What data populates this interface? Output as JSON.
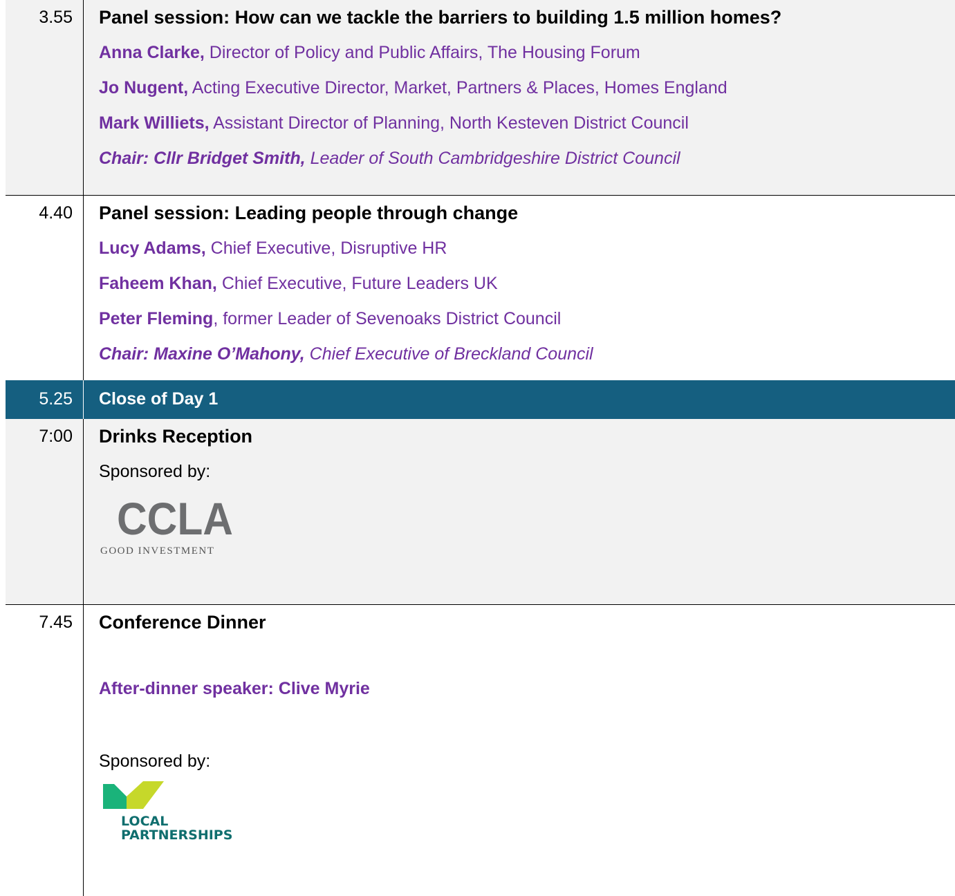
{
  "agenda": {
    "rows": [
      {
        "time": "3.55",
        "title": "Panel session: How can we tackle the barriers to building 1.5 million homes?",
        "speakers": [
          {
            "name": "Anna Clarke,",
            "role": " Director of Policy and Public Affairs, The Housing Forum"
          },
          {
            "name": "Jo Nugent,",
            "role": " Acting Executive Director, Market, Partners & Places, Homes England"
          },
          {
            "name": "Mark Williets,",
            "role": " Assistant Director of Planning, North Kesteven District Council"
          }
        ],
        "chair": {
          "name": "Chair: Cllr Bridget Smith,",
          "role": " Leader of South Cambridgeshire District Council"
        }
      },
      {
        "time": "4.40",
        "title": "Panel session: Leading people through change",
        "speakers": [
          {
            "name": "Lucy Adams,",
            "role": " Chief Executive, Disruptive HR"
          },
          {
            "name": "Faheem Khan,",
            "role": " Chief Executive, Future Leaders UK"
          },
          {
            "name": "Peter Fleming",
            "role": ", former Leader of Sevenoaks District Council"
          }
        ],
        "chair": {
          "name": "Chair: Maxine O’Mahony,",
          "role": " Chief Executive of Breckland Council"
        }
      },
      {
        "time": "5.25",
        "title": "Close of Day 1"
      },
      {
        "time": "7:00",
        "title": "Drinks Reception",
        "sponsored_label": "Sponsored by:",
        "logo": {
          "wordmark": "CCLA",
          "tagline": "GOOD INVESTMENT",
          "color": "#6d6e70"
        }
      },
      {
        "time": "7.45",
        "title": "Conference Dinner",
        "speaker_line": "After-dinner speaker: Clive Myrie",
        "sponsored_label": "Sponsored by:",
        "logo": {
          "line1": "LOCAL",
          "line2": "PARTNERSHIPS",
          "color_text": "#0f6e6e",
          "color_green": "#1ab37a",
          "color_lime": "#c6d82a"
        }
      }
    ]
  },
  "colors": {
    "accent_purple": "#7030a0",
    "highlight_band": "#155f80",
    "row_shade": "#f2f2f2"
  }
}
